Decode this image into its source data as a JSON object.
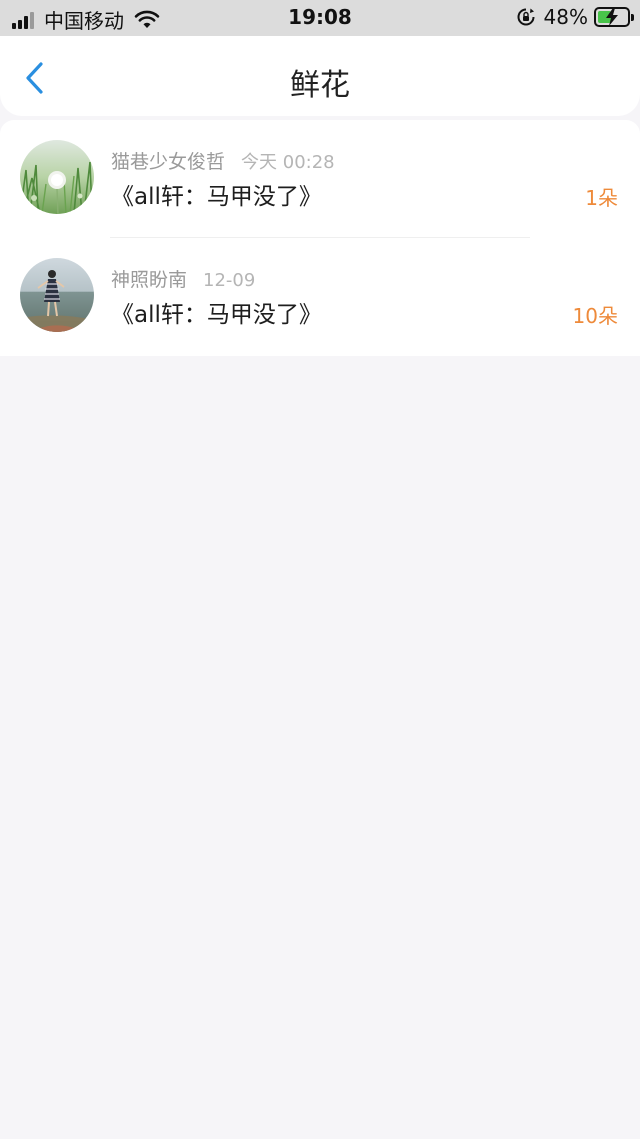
{
  "status_bar": {
    "carrier": "中国移动",
    "time": "19:08",
    "battery_percent": "48%",
    "battery_level": 0.48,
    "icons": [
      "signal-icon",
      "wifi-icon",
      "rotation-lock-icon",
      "battery-charging-icon"
    ]
  },
  "nav": {
    "title": "鲜花",
    "back_icon": "chevron-left-icon",
    "accent_color": "#2a8fe0"
  },
  "list": {
    "count_color": "#ee8a3a",
    "items": [
      {
        "name": "猫巷少女俊哲",
        "time": "今天 00:28",
        "message": "《all轩：马甲没了》",
        "count": "1朵",
        "avatar": "avatar-dandelion"
      },
      {
        "name": "神照盼南",
        "time": "12-09",
        "message": "《all轩：马甲没了》",
        "count": "10朵",
        "avatar": "avatar-girl-by-sea"
      }
    ]
  }
}
